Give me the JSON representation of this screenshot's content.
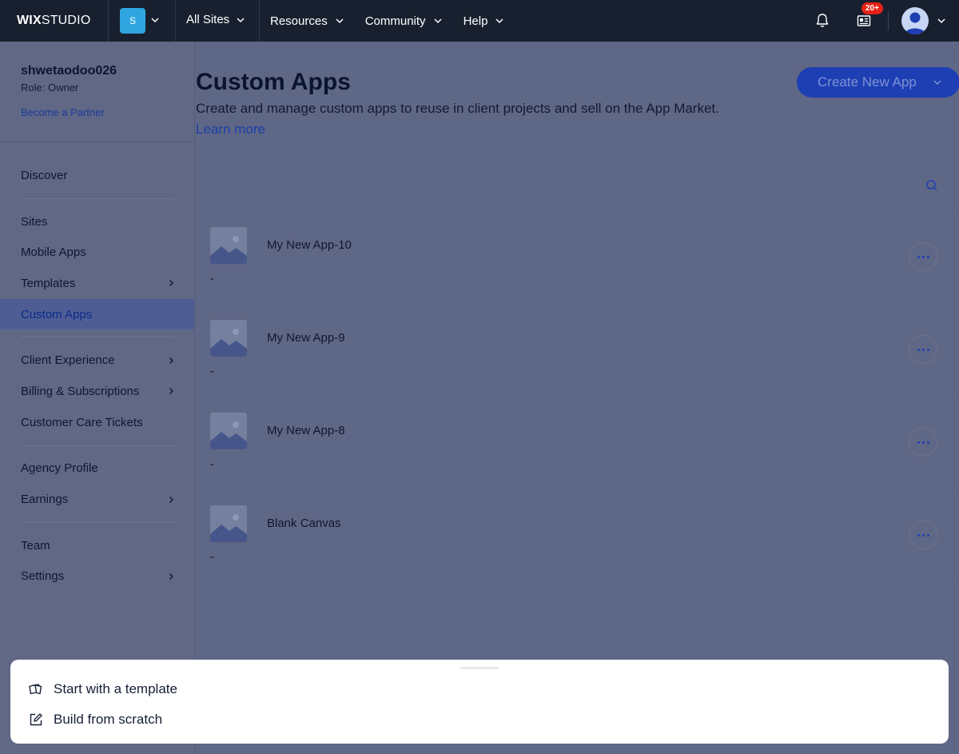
{
  "topbar": {
    "logo_bold": "WIX",
    "logo_light": "STUDIO",
    "site_initial": "S",
    "all_sites": "All Sites",
    "nav": [
      "Resources",
      "Community",
      "Help"
    ],
    "notifications_badge": "20+"
  },
  "sidebar": {
    "username": "shwetaodoo026",
    "role": "Role: Owner",
    "become_partner": "Become a Partner",
    "groups": [
      [
        {
          "label": "Discover",
          "chevron": false
        }
      ],
      [
        {
          "label": "Sites",
          "chevron": false
        },
        {
          "label": "Mobile Apps",
          "chevron": false
        },
        {
          "label": "Templates",
          "chevron": true
        },
        {
          "label": "Custom Apps",
          "chevron": false,
          "active": true
        }
      ],
      [
        {
          "label": "Client Experience",
          "chevron": true
        },
        {
          "label": "Billing & Subscriptions",
          "chevron": true
        },
        {
          "label": "Customer Care Tickets",
          "chevron": false
        }
      ],
      [
        {
          "label": "Agency Profile",
          "chevron": false
        },
        {
          "label": "Earnings",
          "chevron": true
        }
      ],
      [
        {
          "label": "Team",
          "chevron": false
        },
        {
          "label": "Settings",
          "chevron": true
        }
      ]
    ]
  },
  "main": {
    "title": "Custom Apps",
    "description": "Create and manage custom apps to reuse in client projects and sell on the App Market.",
    "learn_more": "Learn more",
    "create_button": "Create New App",
    "apps": [
      {
        "name": "My New App-10",
        "subtitle": "-"
      },
      {
        "name": "My New App-9",
        "subtitle": "-"
      },
      {
        "name": "My New App-8",
        "subtitle": "-"
      },
      {
        "name": "Blank Canvas",
        "subtitle": "-"
      }
    ]
  },
  "sheet": {
    "template_option": "Start with a template",
    "scratch_option": "Build from scratch"
  },
  "colors": {
    "topbar": "#18202f",
    "accent": "#1d3fb3",
    "overlay": "#5f6786",
    "badge": "#e62214"
  }
}
